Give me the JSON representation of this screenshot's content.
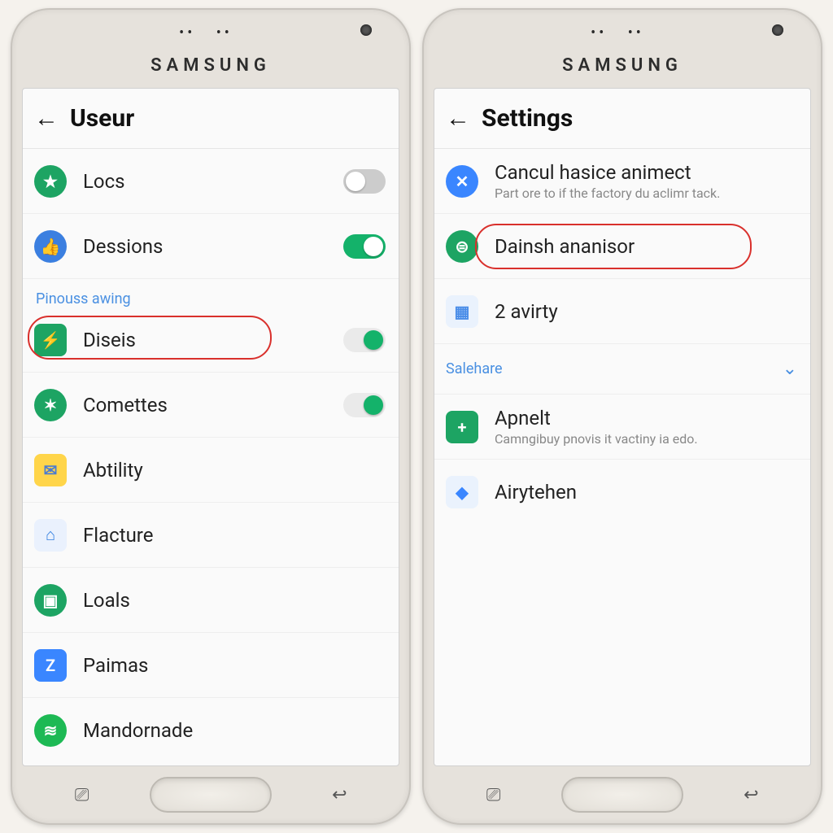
{
  "brand": "SAMSUNG",
  "left": {
    "title": "Useur",
    "section": "Pinouss awing",
    "items": [
      {
        "key": "locs",
        "label": "Locs",
        "iconBg": "#1da463",
        "iconGlyph": "★",
        "toggle": "off"
      },
      {
        "key": "dessions",
        "label": "Dessions",
        "iconBg": "#3b7fe0",
        "iconGlyph": "👍",
        "toggle": "on"
      },
      {
        "key": "diseis",
        "label": "Diseis",
        "iconBg": "#1da463",
        "iconGlyph": "⚡",
        "toggle": "on-dot",
        "highlight": true,
        "square": true
      },
      {
        "key": "comettes",
        "label": "Comettes",
        "iconBg": "#1da463",
        "iconGlyph": "✖",
        "toggle": "on-dot"
      },
      {
        "key": "abtility",
        "label": "Abtility",
        "iconBg": "#ffd54a",
        "iconGlyph": "✉",
        "square": true
      },
      {
        "key": "flacture",
        "label": "Flacture",
        "iconBg": "#2f7de0",
        "iconGlyph": "🏠",
        "square": true
      },
      {
        "key": "loals",
        "label": "Loals",
        "iconBg": "#1da463",
        "iconGlyph": "▣"
      },
      {
        "key": "paimas",
        "label": "Paimas",
        "iconBg": "#3a86ff",
        "iconGlyph": "Z",
        "square": true
      },
      {
        "key": "mandornade",
        "label": "Mandornade",
        "iconBg": "#1db954",
        "iconGlyph": "≋"
      }
    ]
  },
  "right": {
    "title": "Settings",
    "section": "Salehare",
    "items": [
      {
        "key": "cancul",
        "label": "Cancul hasice animect",
        "sub": "Part ore to if the factory du aclimr tack.",
        "iconBg": "#3a86ff",
        "iconGlyph": "✕"
      },
      {
        "key": "dainsh",
        "label": "Dainsh ananisor",
        "iconBg": "#1da463",
        "iconGlyph": "⊜",
        "highlight": true
      },
      {
        "key": "avirty",
        "label": "2 avirty",
        "iconBg": "#5a9df0",
        "iconGlyph": "▦",
        "square": true
      }
    ],
    "section_items": [
      {
        "key": "apnelt",
        "label": "Apnelt",
        "sub": "Camngibuy pnovis it vactiny ia edo.",
        "iconBg": "#1da463",
        "iconGlyph": "+",
        "square": true
      },
      {
        "key": "airytehen",
        "label": "Airytehen",
        "iconBg": "#3a86ff",
        "iconGlyph": "◆",
        "square": true
      }
    ]
  }
}
